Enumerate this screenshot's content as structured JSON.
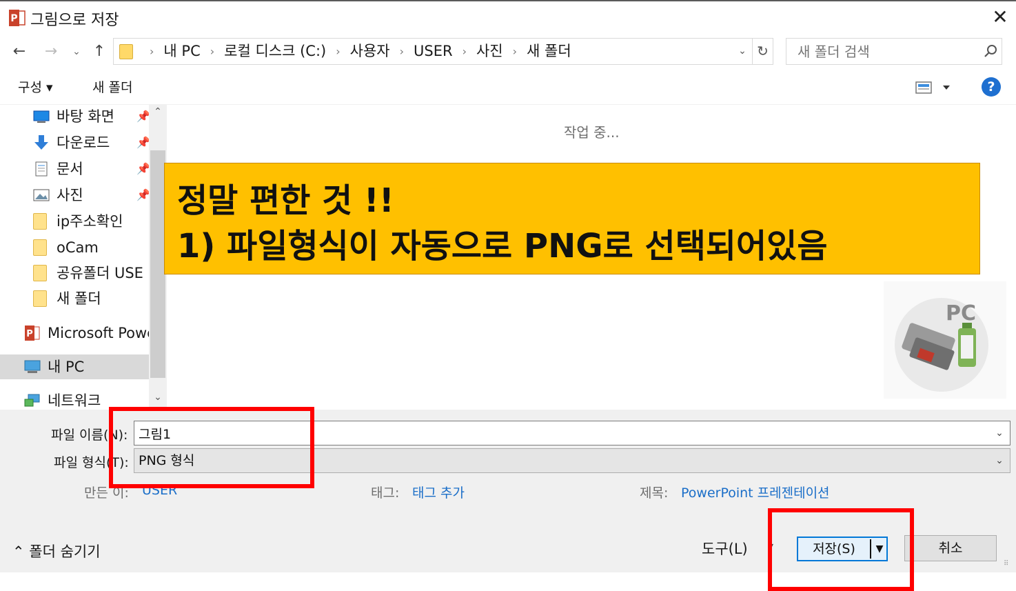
{
  "window": {
    "title": "그림으로 저장",
    "close_glyph": "✕"
  },
  "navigation": {
    "back_glyph": "←",
    "forward_glyph": "→",
    "recent_glyph": "⌄",
    "up_glyph": "↑",
    "breadcrumbs": [
      "내 PC",
      "로컬 디스크 (C:)",
      "사용자",
      "USER",
      "사진",
      "새 폴더"
    ],
    "separator": "›",
    "address_dropdown_glyph": "⌄",
    "refresh_glyph": "↻",
    "search_placeholder": "새 폴더 검색"
  },
  "toolbar": {
    "organize_label": "구성 ▾",
    "new_folder_label": "새 폴더",
    "help_label": "?"
  },
  "sidebar": {
    "items": [
      {
        "label": "바탕 화면",
        "pinned": true,
        "icon": "desktop-icon"
      },
      {
        "label": "다운로드",
        "pinned": true,
        "icon": "download-icon"
      },
      {
        "label": "문서",
        "pinned": true,
        "icon": "document-icon"
      },
      {
        "label": "사진",
        "pinned": true,
        "icon": "pictures-icon"
      },
      {
        "label": "ip주소확인",
        "pinned": false,
        "icon": "folder-icon"
      },
      {
        "label": "oCam",
        "pinned": false,
        "icon": "folder-icon"
      },
      {
        "label": "공유폴더 USE",
        "pinned": false,
        "icon": "folder-icon"
      },
      {
        "label": "새 폴더",
        "pinned": false,
        "icon": "folder-icon"
      },
      {
        "label": "Microsoft Powe",
        "pinned": false,
        "icon": "powerpoint-icon"
      },
      {
        "label": "내 PC",
        "pinned": false,
        "icon": "pc-icon"
      },
      {
        "label": "네트워크",
        "pinned": false,
        "icon": "network-icon"
      }
    ],
    "pin_glyph": "📌",
    "scroll_up_glyph": "⌃",
    "scroll_down_glyph": "⌄"
  },
  "content": {
    "status_text": "작업 중..."
  },
  "annotation": {
    "line1": "정말 편한 것 !!",
    "line2": "1) 파일형식이 자동으로 PNG로 선택되어있음",
    "background_color": "#ffc000"
  },
  "form": {
    "filename_label": "파일 이름(N):",
    "filename_value": "그림1",
    "filetype_label": "파일 형식(T):",
    "filetype_value": "PNG 형식",
    "dropdown_glyph": "⌄",
    "author_label": "만든 이:",
    "author_value": "USER",
    "tags_label": "태그:",
    "tags_value": "태그 추가",
    "title_label": "제목:",
    "title_value": "PowerPoint 프레젠테이션"
  },
  "footer": {
    "hide_folders_label": "⌃  폴더 숨기기",
    "tools_label": "도구(L)",
    "tools_dropdown_glyph": "▾",
    "save_label": "저장(S)",
    "save_dropdown_glyph": "▼",
    "cancel_label": "취소",
    "resize_glyph": "⠿"
  },
  "colors": {
    "highlight": "#ff0000",
    "accent": "#0078d7",
    "link": "#1a6ec8"
  }
}
